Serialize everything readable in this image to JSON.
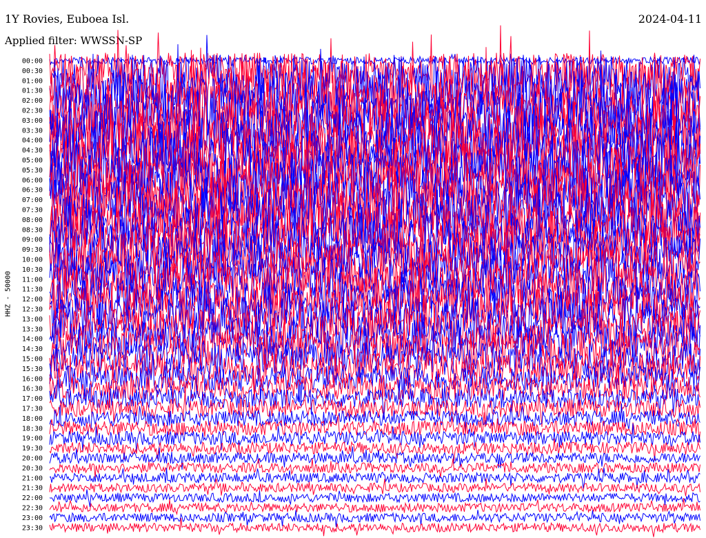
{
  "header": {
    "title": "1Y Rovies, Euboea Isl.",
    "filter": "Applied filter: WWSSN-SP",
    "date": "2024-04-11"
  },
  "chart_data": {
    "type": "line",
    "subtype": "helicorder",
    "ylabel": "HHZ - 50000",
    "row_labels": [
      "00:00",
      "00:30",
      "01:00",
      "01:30",
      "02:00",
      "02:30",
      "03:00",
      "03:30",
      "04:00",
      "04:30",
      "05:00",
      "05:30",
      "06:00",
      "06:30",
      "07:00",
      "07:30",
      "08:00",
      "08:30",
      "09:00",
      "09:30",
      "10:00",
      "10:30",
      "11:00",
      "11:30",
      "12:00",
      "12:30",
      "13:00",
      "13:30",
      "14:00",
      "14:30",
      "15:00",
      "15:30",
      "16:00",
      "16:30",
      "17:00",
      "17:30",
      "18:00",
      "18:30",
      "19:00",
      "19:30",
      "20:00",
      "20:30",
      "21:00",
      "21:30",
      "22:00",
      "22:30",
      "23:00",
      "23:30"
    ],
    "trace_colors": [
      "#0000ff",
      "#ff0033"
    ],
    "row_amplitude": [
      0.35,
      1.8,
      2.6,
      3.0,
      3.0,
      3.0,
      3.0,
      3.0,
      3.0,
      3.0,
      3.0,
      3.0,
      3.0,
      3.0,
      3.0,
      3.0,
      2.8,
      2.6,
      2.5,
      2.5,
      2.4,
      2.4,
      2.3,
      2.3,
      2.2,
      2.2,
      2.1,
      2.0,
      1.9,
      1.8,
      1.7,
      1.5,
      1.3,
      1.2,
      1.0,
      0.9,
      0.8,
      0.75,
      0.7,
      0.6,
      0.55,
      0.5,
      0.5,
      0.45,
      0.45,
      0.45,
      0.45,
      0.45
    ],
    "grid": false
  }
}
